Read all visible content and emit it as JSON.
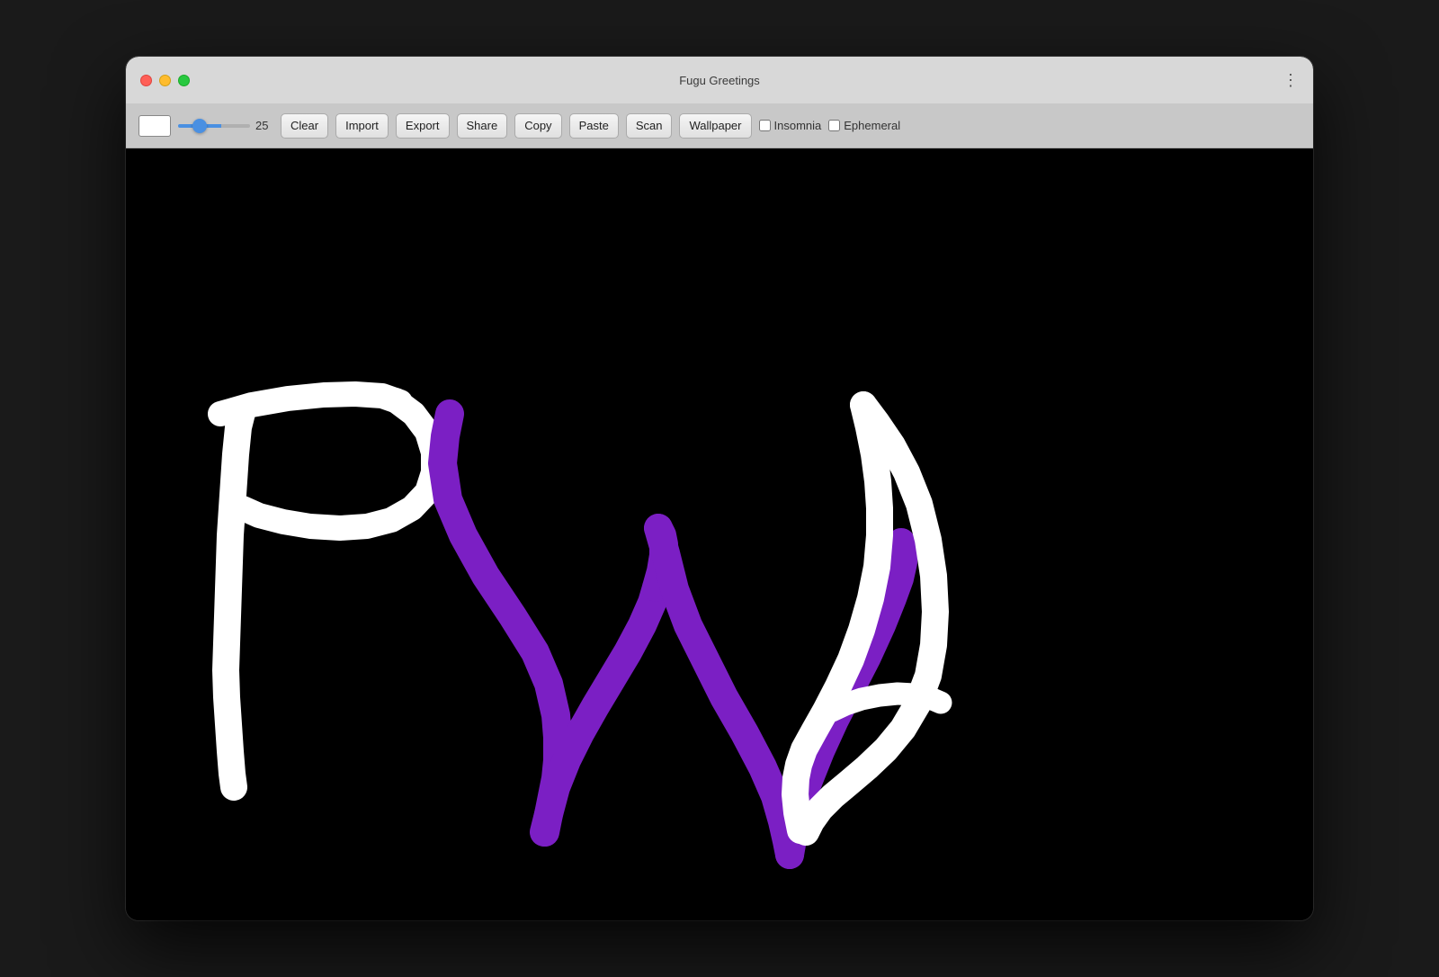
{
  "window": {
    "title": "Fugu Greetings",
    "traffic_lights": {
      "close_color": "#ff5f57",
      "minimize_color": "#febc2e",
      "maximize_color": "#28c840"
    }
  },
  "toolbar": {
    "color_swatch": "#ffffff",
    "slider_value": "25",
    "buttons": [
      {
        "id": "clear",
        "label": "Clear"
      },
      {
        "id": "import",
        "label": "Import"
      },
      {
        "id": "export",
        "label": "Export"
      },
      {
        "id": "share",
        "label": "Share"
      },
      {
        "id": "copy",
        "label": "Copy"
      },
      {
        "id": "paste",
        "label": "Paste"
      },
      {
        "id": "scan",
        "label": "Scan"
      },
      {
        "id": "wallpaper",
        "label": "Wallpaper"
      }
    ],
    "checkboxes": [
      {
        "id": "insomnia",
        "label": "Insomnia",
        "checked": false
      },
      {
        "id": "ephemeral",
        "label": "Ephemeral",
        "checked": false
      }
    ]
  },
  "canvas": {
    "background": "#000000"
  }
}
